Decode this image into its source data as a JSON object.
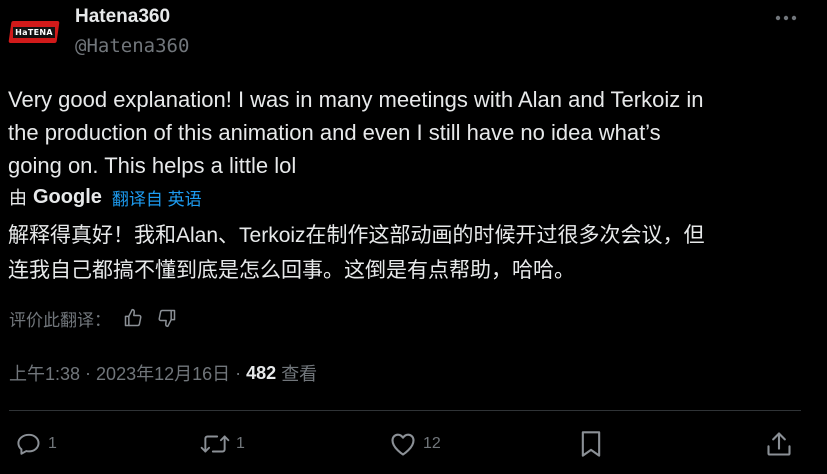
{
  "author": {
    "name": "Hatena360",
    "handle": "@Hatena360",
    "avatar_text": "HaTENA"
  },
  "tweet": {
    "text_lines": [
      "Very good explanation! I was in many meetings with Alan and Terkoiz in",
      "the production of this animation and even I still have no idea what’s",
      "going on. This helps a little lol"
    ]
  },
  "translation": {
    "by_label": "由",
    "provider": "Google",
    "link": "翻译自 英语",
    "text_lines": [
      "解释得真好！我和Alan、Terkoiz在制作这部动画的时候开过很多次会议，但",
      "连我自己都搞不懂到底是怎么回事。这倒是有点帮助，哈哈。"
    ],
    "rate_label": "评价此翻译："
  },
  "meta": {
    "time": "上午1:38",
    "sep1": "·",
    "date": "2023年12月16日",
    "sep2": "·",
    "views_count": "482",
    "views_label": "查看"
  },
  "actions": {
    "replies": "1",
    "reposts": "1",
    "likes": "12"
  },
  "icons": [
    "more-icon",
    "thumbs-up-icon",
    "thumbs-down-icon",
    "reply-icon",
    "repost-icon",
    "like-icon",
    "bookmark-icon",
    "share-icon"
  ],
  "colors": {
    "background": "#000000",
    "text": "#e7e9ea",
    "muted": "#71767b",
    "link": "#1d9bf0",
    "brand": "#d11a1a"
  }
}
